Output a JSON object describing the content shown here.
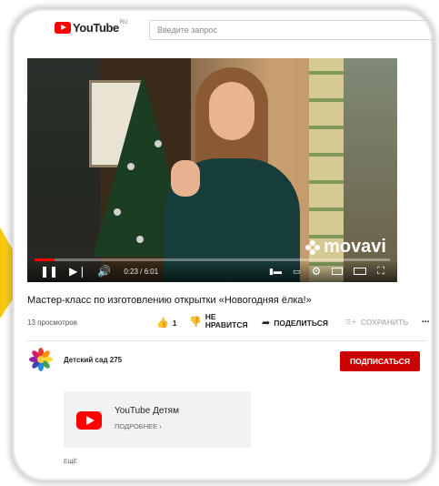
{
  "header": {
    "logo_text": "YouTube",
    "logo_region": "RU",
    "search_placeholder": "Введите запрос"
  },
  "player": {
    "time": "0:23 / 6:01",
    "progress_fraction": 0.056,
    "watermark": "movavi"
  },
  "video": {
    "title": "Мастер-класс по изготовлению открытки «Новогодняя ёлка!»",
    "views": "13 просмотров",
    "likes": "1",
    "dislike_label": "НЕ\nНРАВИТСЯ",
    "share_label": "ПОДЕЛИТЬСЯ",
    "save_label": "СОХРАНИТЬ",
    "more_icon": "⋯"
  },
  "channel": {
    "name": "Детский сад 275",
    "subscribe_label": "ПОДПИСАТЬСЯ"
  },
  "promo": {
    "title": "YouTube Детям",
    "more_label": "ПОДРОБНЕЕ"
  },
  "more_label": "ЕЩЁ",
  "colors": {
    "brand_red": "#ff0000",
    "subscribe_red": "#cc0000"
  }
}
